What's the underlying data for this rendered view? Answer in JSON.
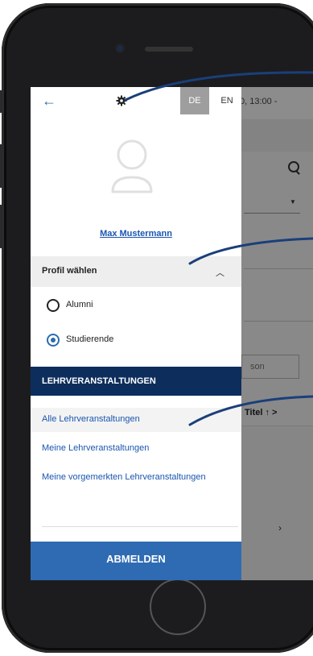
{
  "background_app": {
    "time_fragment": "0, 13:00 -",
    "search_input_fragment": "son",
    "sort_fragment": "Titel ↑ >"
  },
  "drawer": {
    "back_icon": "arrow-left",
    "settings_icon": "gear",
    "languages": [
      {
        "code": "DE",
        "selected": true
      },
      {
        "code": "EN",
        "selected": false
      }
    ],
    "user_name": "Max Mustermann",
    "profile": {
      "title": "Profil wählen",
      "expanded": true,
      "options": [
        {
          "label": "Alumni",
          "checked": false
        },
        {
          "label": "Studierende",
          "checked": true
        }
      ]
    },
    "section_title": "LEHRVERANSTALTUNGEN",
    "nav_items": [
      {
        "label": "Alle Lehrveranstaltungen",
        "active": true
      },
      {
        "label": "Meine Lehrveranstaltungen",
        "active": false
      },
      {
        "label": "Meine vorgemerkten Lehrveranstaltungen",
        "active": false
      }
    ],
    "logout_label": "ABMELDEN"
  },
  "colors": {
    "nav_blue": "#1a56b0",
    "section_navy": "#0d2e5c",
    "logout_blue": "#2f6bb3",
    "lang_selected_bg": "#9e9e9e",
    "phone_body": "#1c1c1e"
  }
}
